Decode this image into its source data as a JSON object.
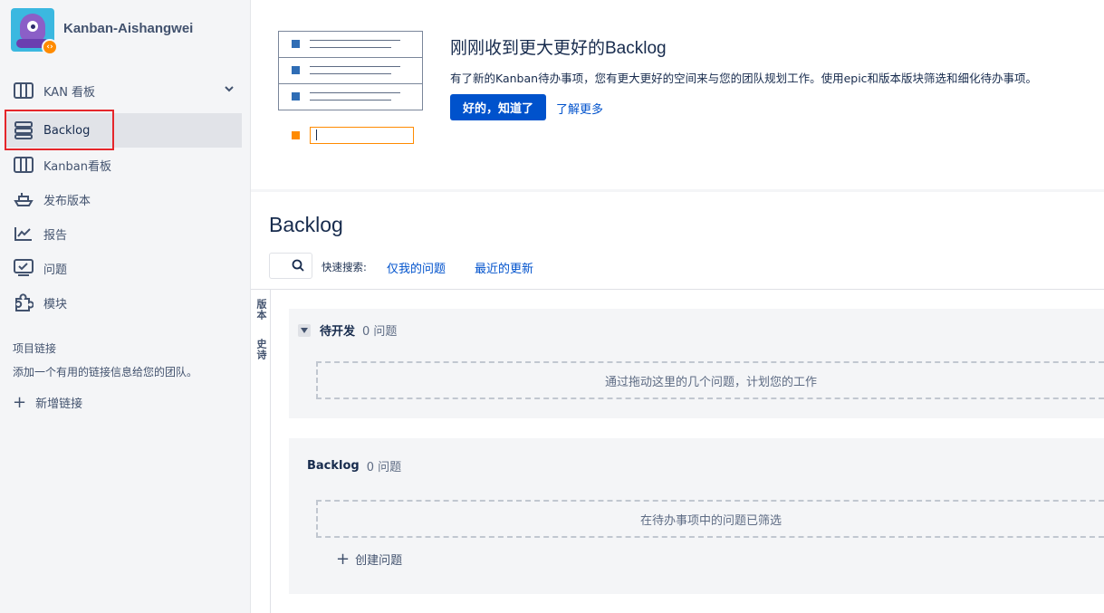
{
  "project": {
    "name": "Kanban-Aishangwei",
    "badge_glyph": "‹›"
  },
  "sidebar": {
    "items": [
      {
        "label": "KAN 看板",
        "icon": "board-icon"
      },
      {
        "label": "Backlog",
        "icon": "backlog-icon"
      },
      {
        "label": "Kanban看板",
        "icon": "columns-icon"
      },
      {
        "label": "发布版本",
        "icon": "ship-icon"
      },
      {
        "label": "报告",
        "icon": "chart-icon"
      },
      {
        "label": "问题",
        "icon": "issues-icon"
      },
      {
        "label": "模块",
        "icon": "puzzle-icon"
      }
    ],
    "project_links": {
      "title": "项目链接",
      "description": "添加一个有用的链接信息给您的团队。",
      "add_label": "新增链接"
    }
  },
  "banner": {
    "title": "刚刚收到更大更好的Backlog",
    "description": "有了新的Kanban待办事项，您有更大更好的空间来与您的团队规划工作。使用epic和版本版块筛选和细化待办事项。",
    "ok_label": "好的，知道了",
    "learn_more_label": "了解更多"
  },
  "main": {
    "title": "Backlog",
    "quick_search_label": "快速搜索:",
    "quick_filters": [
      "仅我的问题",
      "最近的更新"
    ],
    "side_tabs": [
      "版本",
      "史诗"
    ]
  },
  "sections": [
    {
      "name": "待开发",
      "count": "0 问题",
      "empty_text": "通过拖动这里的几个问题，计划您的工作"
    },
    {
      "name": "Backlog",
      "count": "0 问题",
      "empty_text": "在待办事项中的问题已筛选",
      "create_label": "创建问题"
    }
  ],
  "colors": {
    "accent": "#0052cc",
    "highlight": "#e5262b",
    "orange": "#ff8b00"
  }
}
